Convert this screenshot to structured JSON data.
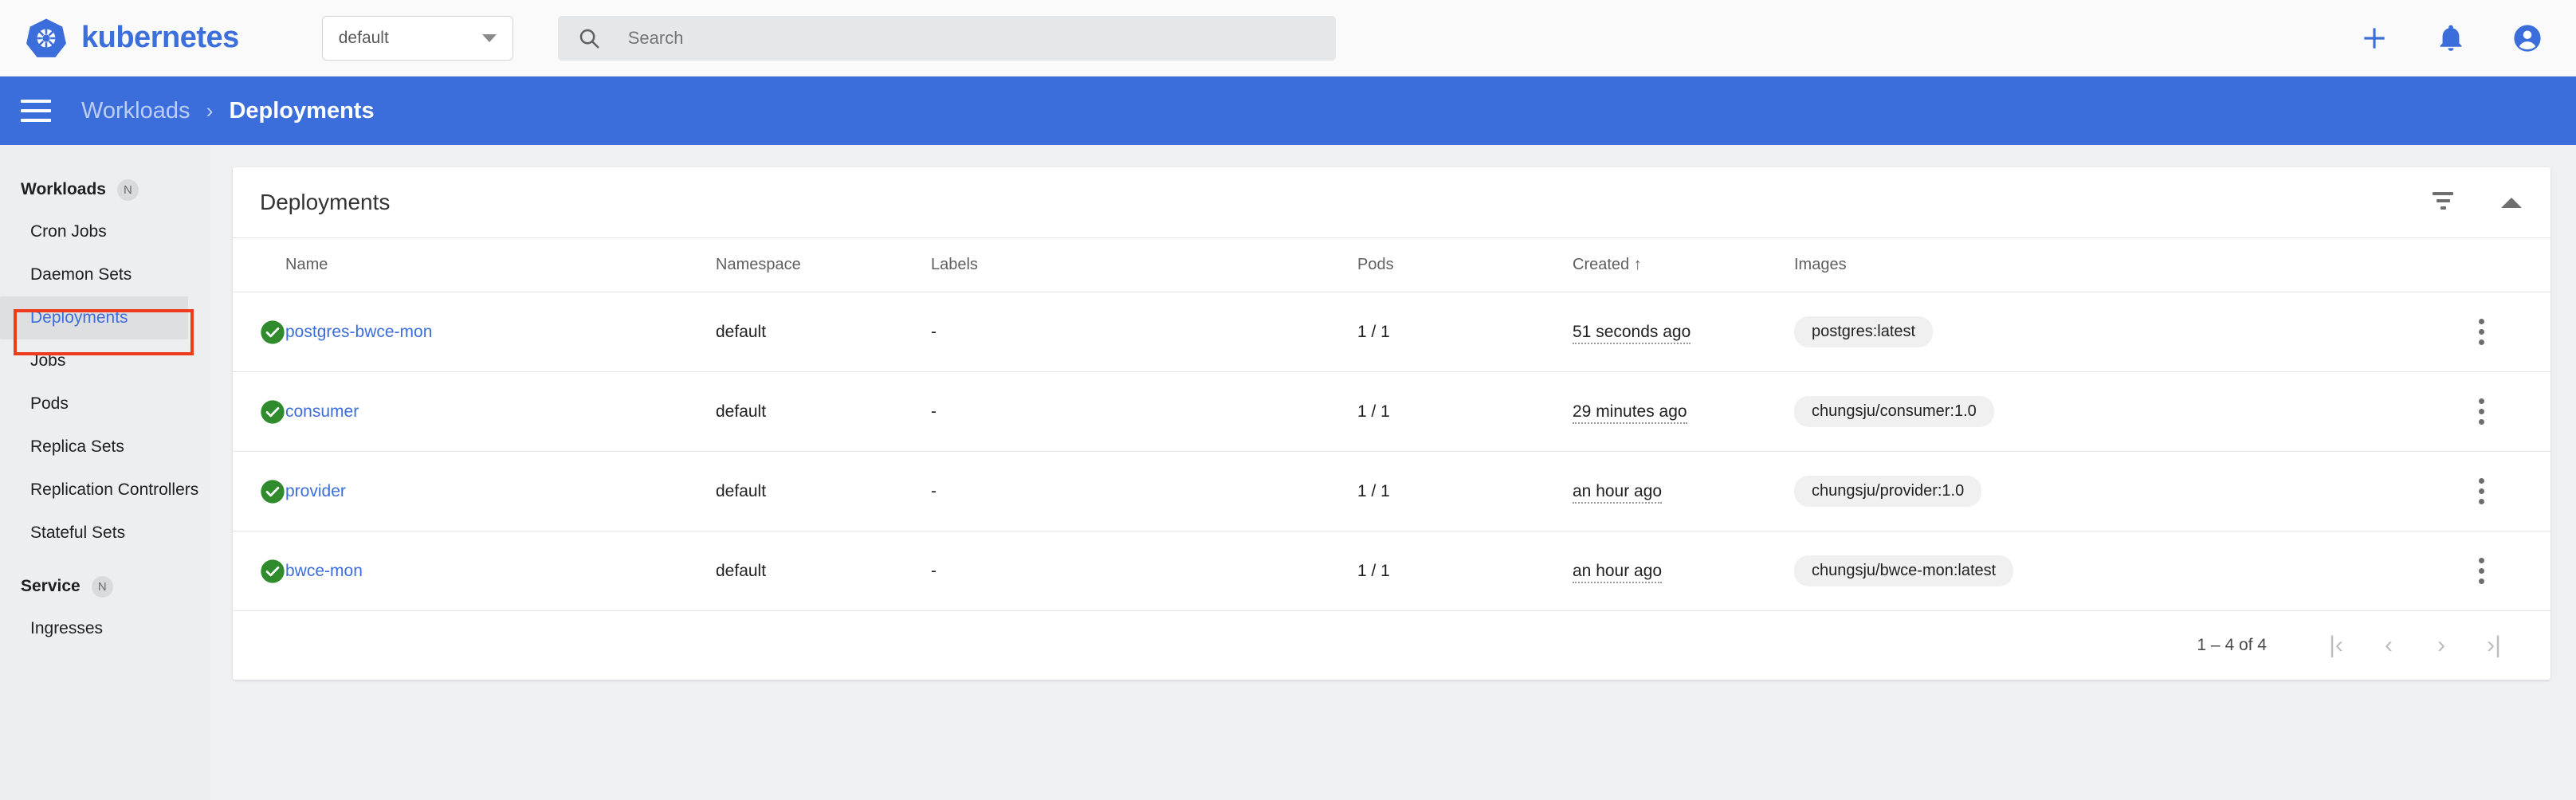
{
  "topbar": {
    "brand": "kubernetes",
    "logo_icon": "kubernetes-helm-logo",
    "namespace_value": "default",
    "namespace_caret_icon": "chevron-down-icon",
    "search_placeholder": "Search",
    "search_value": "",
    "search_icon": "search-icon",
    "add_icon": "plus-icon",
    "notifications_icon": "bell-icon",
    "account_icon": "account-circle-icon",
    "accent_color": "#3c6edb",
    "background": "#fafafa"
  },
  "breadcrumb": {
    "menu_icon": "hamburger-menu-icon",
    "parent": "Workloads",
    "separator": "›",
    "current": "Deployments",
    "bar_color": "#3c6edb"
  },
  "sidebar": {
    "background": "#eceef0",
    "sections": [
      {
        "label": "Workloads",
        "badge": "N",
        "items": [
          {
            "label": "Cron Jobs",
            "active": false
          },
          {
            "label": "Daemon Sets",
            "active": false
          },
          {
            "label": "Deployments",
            "active": true
          },
          {
            "label": "Jobs",
            "active": false
          },
          {
            "label": "Pods",
            "active": false
          },
          {
            "label": "Replica Sets",
            "active": false
          },
          {
            "label": "Replication Controllers",
            "active": false
          },
          {
            "label": "Stateful Sets",
            "active": false
          }
        ]
      },
      {
        "label": "Service",
        "badge": "N",
        "items": [
          {
            "label": "Ingresses",
            "active": false
          }
        ]
      }
    ],
    "annotation_color": "#ee3b1e"
  },
  "card": {
    "title": "Deployments",
    "filter_icon": "filter-icon",
    "collapse_icon": "caret-up-icon",
    "columns": [
      {
        "key": "status",
        "label": ""
      },
      {
        "key": "name",
        "label": "Name"
      },
      {
        "key": "namespace",
        "label": "Namespace"
      },
      {
        "key": "labels",
        "label": "Labels"
      },
      {
        "key": "pods",
        "label": "Pods"
      },
      {
        "key": "created",
        "label": "Created",
        "sort": "↑"
      },
      {
        "key": "images",
        "label": "Images"
      },
      {
        "key": "menu",
        "label": ""
      }
    ],
    "rows": [
      {
        "status_icon": "check-circle-icon",
        "status_color": "#308b2c",
        "name": "postgres-bwce-mon",
        "namespace": "default",
        "labels": "-",
        "pods": "1 / 1",
        "created": "51 seconds ago",
        "images": "postgres:latest",
        "menu_icon": "more-vert-icon"
      },
      {
        "status_icon": "check-circle-icon",
        "status_color": "#308b2c",
        "name": "consumer",
        "namespace": "default",
        "labels": "-",
        "pods": "1 / 1",
        "created": "29 minutes ago",
        "images": "chungsju/consumer:1.0",
        "menu_icon": "more-vert-icon"
      },
      {
        "status_icon": "check-circle-icon",
        "status_color": "#308b2c",
        "name": "provider",
        "namespace": "default",
        "labels": "-",
        "pods": "1 / 1",
        "created": "an hour ago",
        "images": "chungsju/provider:1.0",
        "menu_icon": "more-vert-icon"
      },
      {
        "status_icon": "check-circle-icon",
        "status_color": "#308b2c",
        "name": "bwce-mon",
        "namespace": "default",
        "labels": "-",
        "pods": "1 / 1",
        "created": "an hour ago",
        "images": "chungsju/bwce-mon:latest",
        "menu_icon": "more-vert-icon"
      }
    ],
    "pagination": {
      "range_label": "1 – 4 of 4",
      "first_icon": "|‹",
      "prev_icon": "‹",
      "next_icon": "›",
      "last_icon": "›|"
    }
  }
}
